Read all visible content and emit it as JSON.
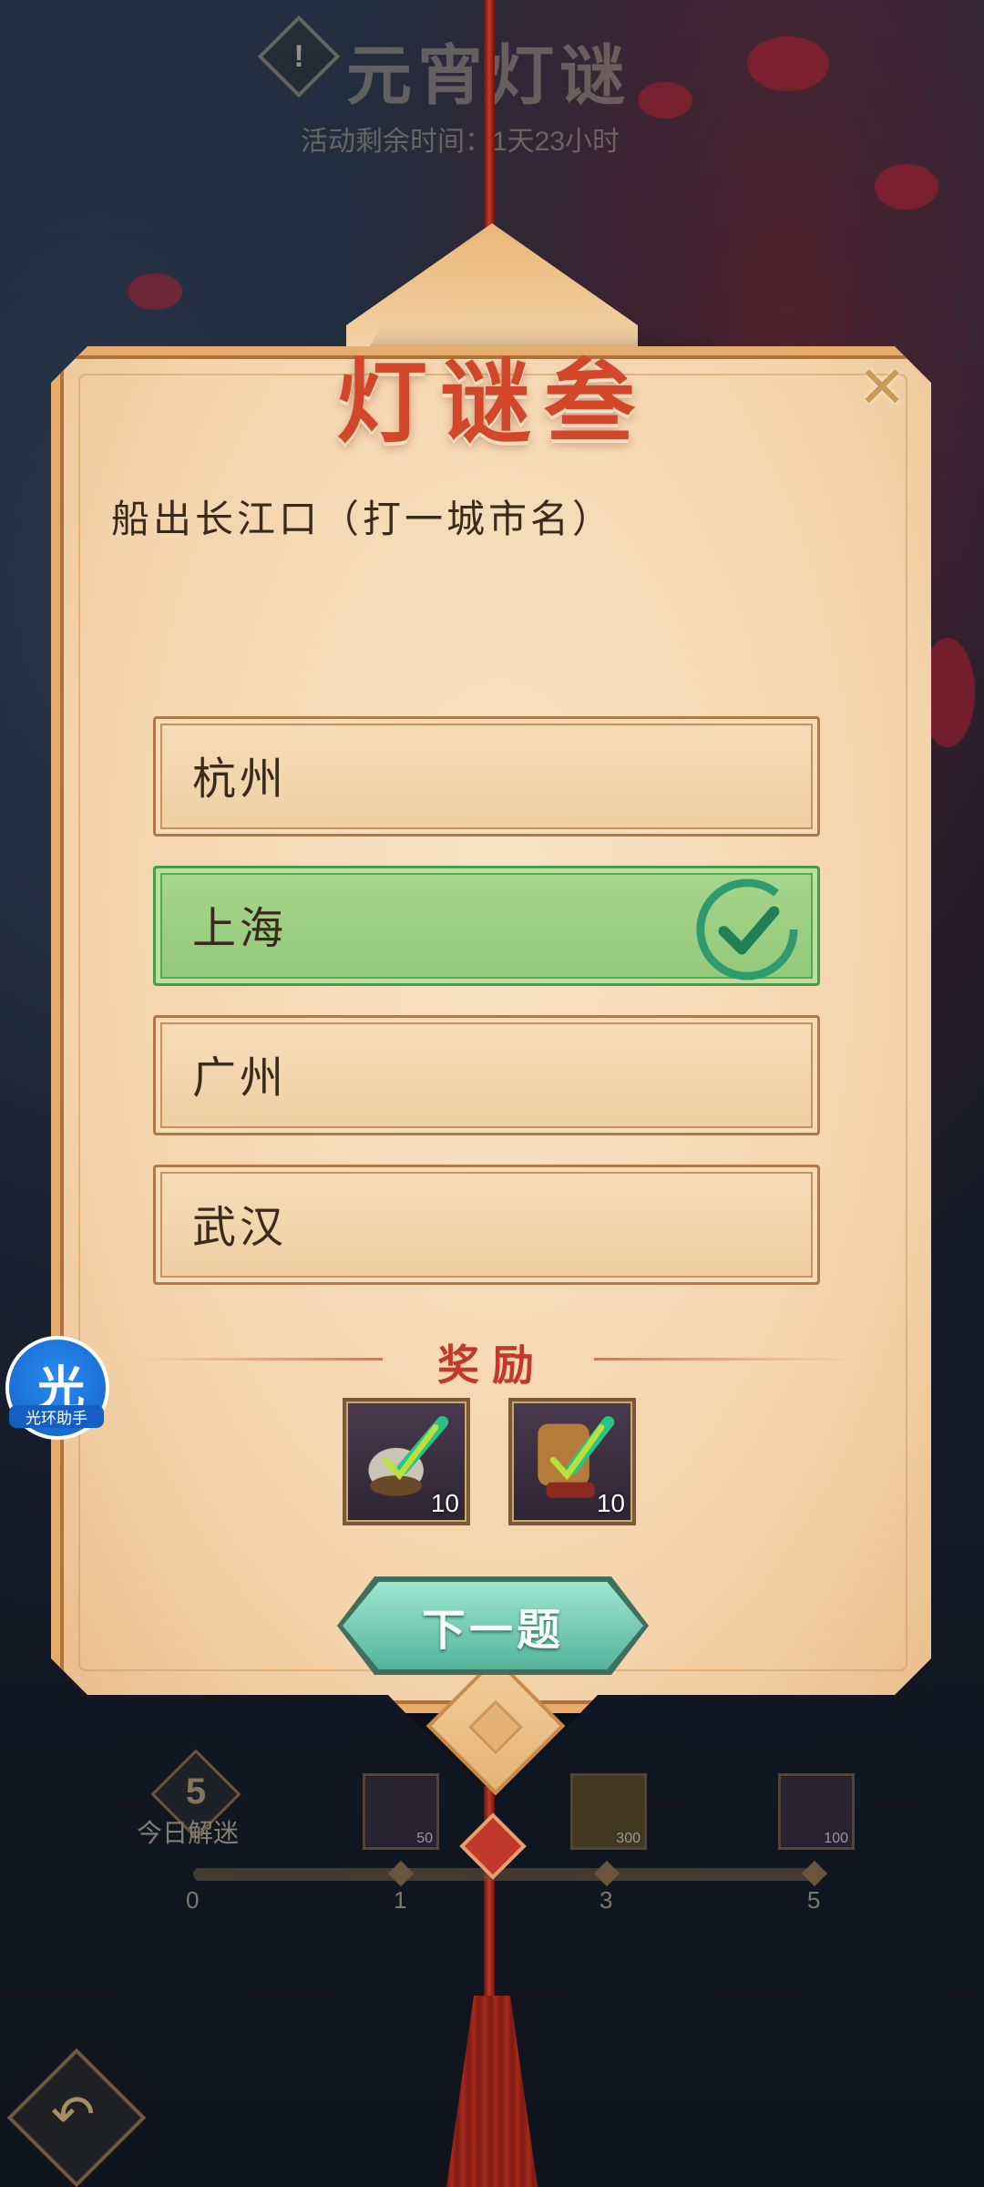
{
  "header": {
    "info_icon": "!",
    "title": "元宵灯谜",
    "time_remaining": "活动剩余时间：1天23小时"
  },
  "card": {
    "title": "灯谜叁",
    "close_icon": "✕",
    "question": "船出长江口（打一城市名）",
    "options": [
      {
        "label": "杭州",
        "selected": false
      },
      {
        "label": "上海",
        "selected": true
      },
      {
        "label": "广州",
        "selected": false
      },
      {
        "label": "武汉",
        "selected": false
      }
    ],
    "reward_title": "奖励",
    "rewards": [
      {
        "icon": "lute-icon",
        "count": "10"
      },
      {
        "icon": "scroll-icon",
        "count": "10"
      }
    ],
    "next_button": "下一题"
  },
  "assistant": {
    "char": "光",
    "label": "光环助手"
  },
  "progress": {
    "solved_today": "5",
    "solved_label": "今日解迷",
    "ticks": [
      "0",
      "1",
      "3",
      "5"
    ],
    "rewards": [
      {
        "count": "50"
      },
      {
        "count": "300"
      },
      {
        "count": "100"
      }
    ]
  },
  "colors": {
    "accent_red": "#d2472a",
    "correct_green": "#92c879",
    "next_button": "#53b59a"
  }
}
